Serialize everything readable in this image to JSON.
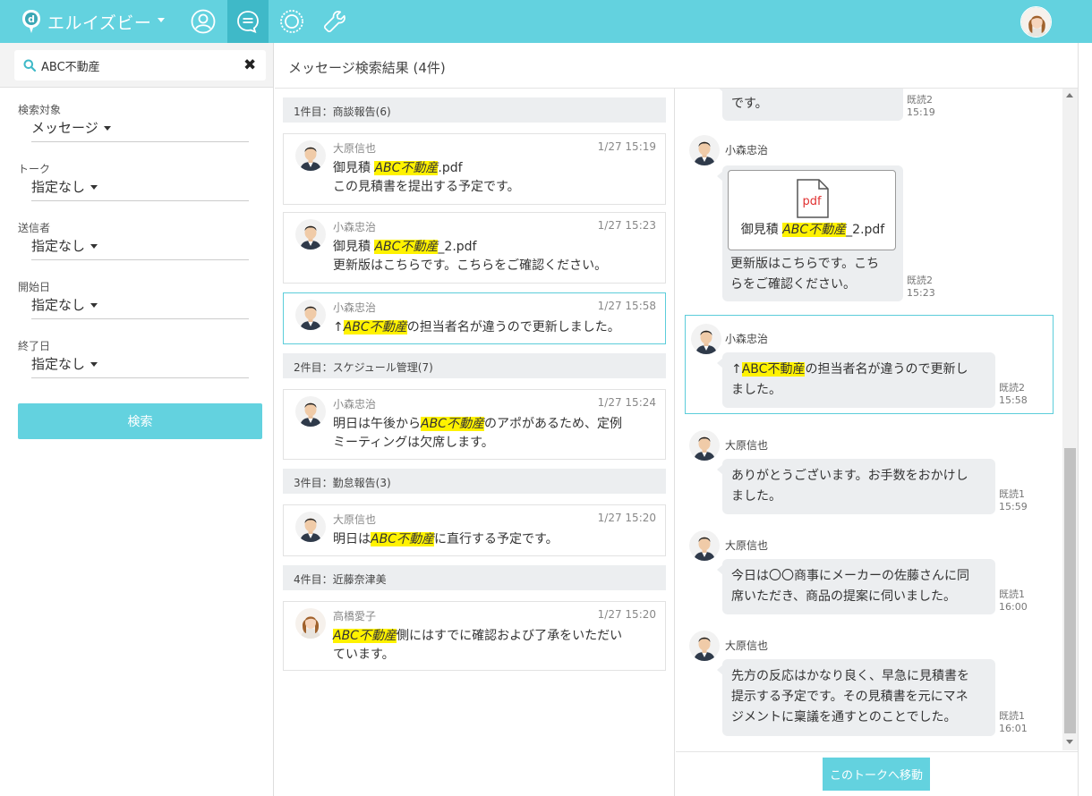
{
  "header": {
    "brand": "エルイズビー",
    "nav": [
      {
        "name": "profile-icon"
      },
      {
        "name": "chat-icon",
        "active": true
      },
      {
        "name": "settings-icon"
      },
      {
        "name": "wrench-icon"
      }
    ],
    "accent_color": "#63d2df"
  },
  "search": {
    "value": "ABC不動産",
    "clear_label": "✖"
  },
  "filters": [
    {
      "label": "検索対象",
      "value": "メッセージ"
    },
    {
      "label": "トーク",
      "value": "指定なし"
    },
    {
      "label": "送信者",
      "value": "指定なし"
    },
    {
      "label": "開始日",
      "value": "指定なし"
    },
    {
      "label": "終了日",
      "value": "指定なし"
    }
  ],
  "search_button": "検索",
  "results": {
    "title": "メッセージ検索結果 (4件)",
    "groups": [
      {
        "heading": "1件目：商談報告(6)",
        "cards": [
          {
            "sender": "大原信也",
            "time": "1/27 15:19",
            "pre": "御見積 ",
            "hit": "ABC不動産",
            "post": ".pdf",
            "line2": "この見積書を提出する予定です。"
          },
          {
            "sender": "小森忠治",
            "time": "1/27 15:23",
            "pre": "御見積 ",
            "hit": "ABC不動産",
            "post": "_2.pdf",
            "line2": "更新版はこちらです。こちらをご確認ください。"
          },
          {
            "sender": "小森忠治",
            "time": "1/27 15:58",
            "pre": "↑",
            "hit": "ABC不動産",
            "post": "の担当者名が違うので更新しました。",
            "line2": ""
          }
        ]
      },
      {
        "heading": "2件目：スケジュール管理(7)",
        "cards": [
          {
            "sender": "小森忠治",
            "time": "1/27 15:24",
            "pre": "明日は午後から",
            "hit": "ABC不動産",
            "post": "のアポがあるため、定例",
            "line2": "ミーティングは欠席します。"
          }
        ]
      },
      {
        "heading": "3件目：勤怠報告(3)",
        "cards": [
          {
            "sender": "大原信也",
            "time": "1/27 15:20",
            "pre": "明日は",
            "hit": "ABC不動産",
            "post": "に直行する予定です。",
            "line2": ""
          }
        ]
      },
      {
        "heading": "4件目：近藤奈津美",
        "cards": [
          {
            "sender": "高橋愛子",
            "time": "1/27 15:20",
            "pre": "",
            "hit": "ABC不動産",
            "post": "側にはすでに確認および了承をいただい",
            "line2": "ています。"
          }
        ]
      }
    ]
  },
  "thread": {
    "top_fragment": {
      "text": "です。",
      "read": "既読2",
      "time": "15:19"
    },
    "messages": [
      {
        "sender": "小森忠治",
        "pdf_label": "pdf",
        "pdf_pre": "御見積 ",
        "pdf_hit": "ABC不動産",
        "pdf_post": "_2.pdf",
        "line1": "更新版はこちらです。こち",
        "line2": "らをご確認ください。",
        "read": "既読2",
        "time": "15:23"
      },
      {
        "sender": "小森忠治",
        "pre": "↑",
        "hit": "ABC不動産",
        "line1_post": "の担当者名が違うので更新し",
        "line2": "ました。",
        "read": "既読2",
        "time": "15:58"
      },
      {
        "sender": "大原信也",
        "line1": "ありがとうございます。お手数をおかけし",
        "line2": "ました。",
        "read": "既読1",
        "time": "15:59"
      },
      {
        "sender": "大原信也",
        "line1": "今日は〇〇商事にメーカーの佐藤さんに同",
        "line2": "席いただき、商品の提案に伺いました。",
        "read": "既読1",
        "time": "16:00"
      },
      {
        "sender": "大原信也",
        "line1": "先方の反応はかなり良く、早急に見積書を",
        "line2": "提示する予定です。その見積書を元にマネ",
        "line3": "ジメントに稟議を通すとのことでした。",
        "read": "既読1",
        "time": "16:01"
      }
    ],
    "goto_button": "このトークへ移動"
  }
}
